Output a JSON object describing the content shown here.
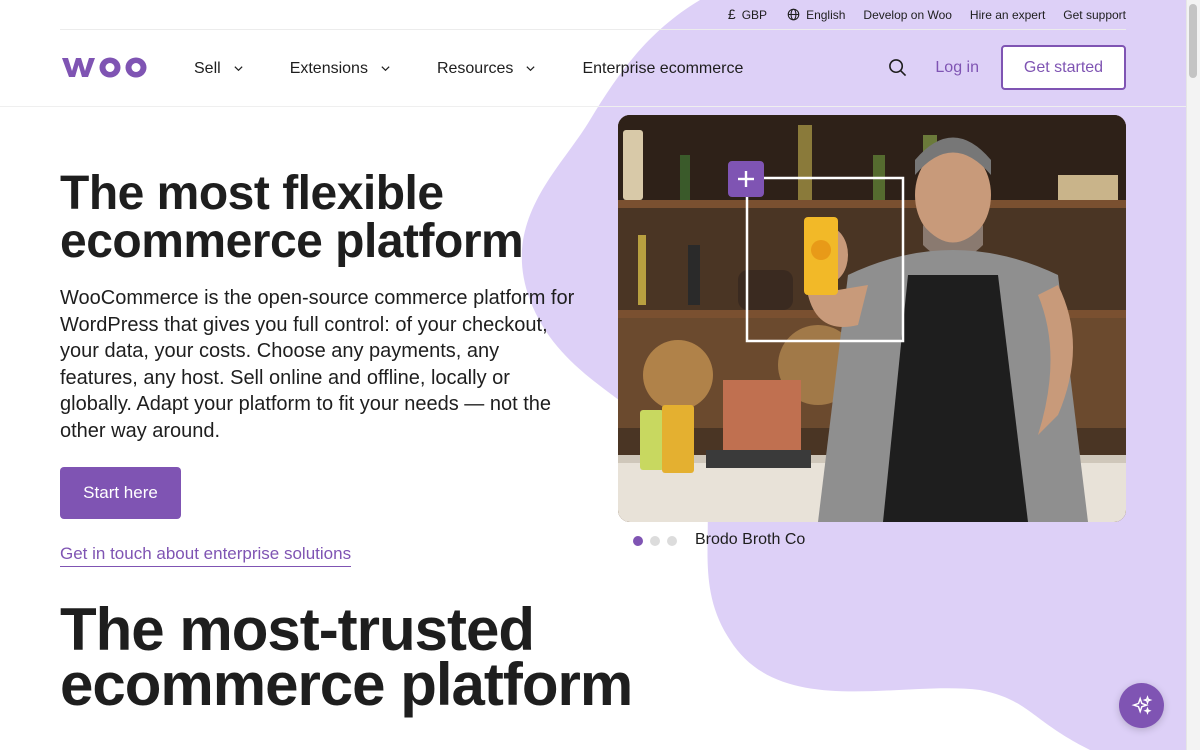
{
  "colors": {
    "brand": "#7f54b3",
    "blob": "#ddd0f7",
    "text": "#1e1e1e"
  },
  "utility_bar": {
    "currency": "GBP",
    "language": "English",
    "develop": "Develop on Woo",
    "hire": "Hire an expert",
    "support": "Get support"
  },
  "header": {
    "logo_text": "woo",
    "nav": [
      {
        "label": "Sell",
        "icon": "chevron-down-icon"
      },
      {
        "label": "Extensions",
        "icon": "chevron-down-icon"
      },
      {
        "label": "Resources",
        "icon": "chevron-down-icon"
      },
      {
        "label": "Enterprise ecommerce"
      }
    ],
    "login": "Log in",
    "get_started": "Get started"
  },
  "hero": {
    "title": "The most flexible ecommerce platform",
    "description": "WooCommerce is the open-source commerce platform for WordPress that gives you full control: of your checkout, your data, your costs. Choose any payments, any features, any host. Sell online and offline, locally or globally. Adapt your platform to fit your needs — not the other way around.",
    "cta": "Start here",
    "enterprise_link": "Get in touch about enterprise solutions",
    "image_caption": "Brodo Broth Co",
    "carousel": {
      "total": 3,
      "active": 0
    }
  },
  "section2": {
    "title": "The most-trusted ecommerce platform"
  },
  "icons": {
    "search": "search-icon",
    "globe": "globe-icon",
    "currency": "pound-icon",
    "ai": "sparkle-icon",
    "plus": "plus-icon"
  }
}
